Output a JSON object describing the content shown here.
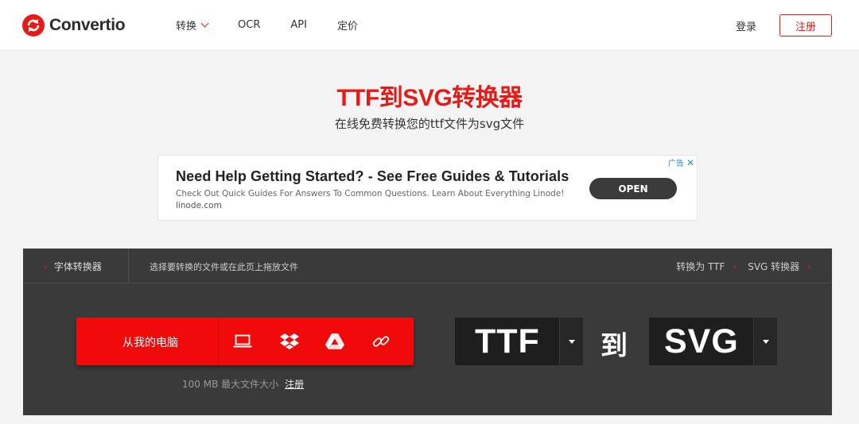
{
  "header": {
    "logo_text": "Convertio",
    "nav": [
      {
        "label": "转换",
        "has_dropdown": true
      },
      {
        "label": "OCR"
      },
      {
        "label": "API"
      },
      {
        "label": "定价"
      }
    ],
    "login_label": "登录",
    "signup_label": "注册"
  },
  "hero": {
    "title": "TTF到SVG转换器",
    "subtitle": "在线免费转换您的ttf文件为svg文件"
  },
  "ad": {
    "headline": "Need Help Getting Started? - See Free Guides & Tutorials",
    "description": "Check Out Quick Guides For Answers To Common Questions. Learn About Everything Linode!",
    "domain": "linode.com",
    "cta": "OPEN",
    "ad_label": "广告",
    "close_icon": "close-icon"
  },
  "converter": {
    "crumb_left": "字体转换器",
    "hint": "选择要转换的文件或在此页上拖放文件",
    "crumb_right_1": "转换为 TTF",
    "crumb_right_2": "SVG 转换器",
    "upload_label": "从我的电脑",
    "sources": [
      "computer-icon",
      "dropbox-icon",
      "google-drive-icon",
      "url-link-icon"
    ],
    "limit_text": "100 MB 最大文件大小",
    "limit_link": "注册",
    "from_format": "TTF",
    "to_label": "到",
    "to_format": "SVG"
  },
  "colors": {
    "brand_red": "#e41b17",
    "upload_red": "#f10a0a",
    "panel_bg": "#3a3a3a",
    "format_bg": "#1e1e1e"
  }
}
